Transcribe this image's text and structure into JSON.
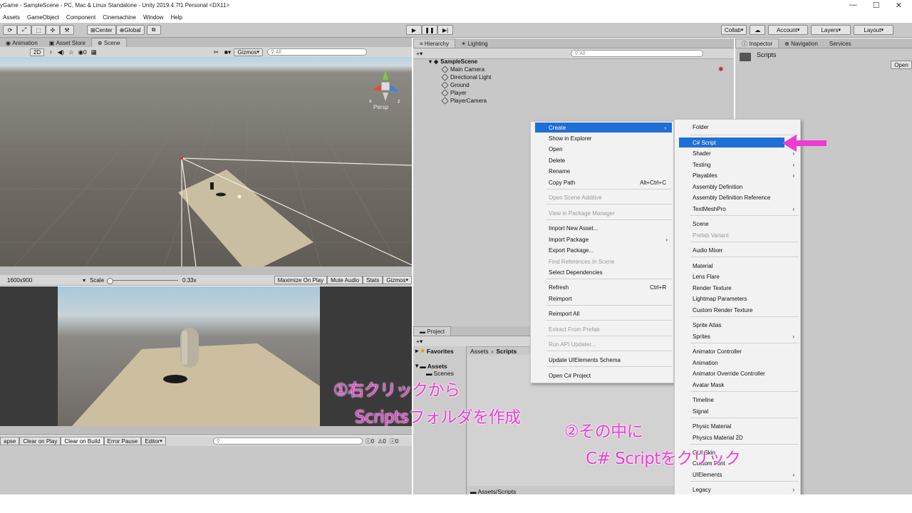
{
  "window": {
    "title": "yGame - SampleScene - PC, Mac & Linux Standalone - Unity 2019.4.7f1 Personal <DX11>",
    "controls": [
      "—",
      "☐",
      "✕"
    ]
  },
  "menubar": [
    "Assets",
    "GameObject",
    "Component",
    "Cinemachine",
    "Window",
    "Help"
  ],
  "toolbar": {
    "center": "Center",
    "global": "Global",
    "collab": "Collab",
    "account": "Account",
    "layers": "Layers",
    "layout": "Layout"
  },
  "scene_tabs": [
    "Animation",
    "Asset Store",
    "Scene"
  ],
  "scene_bar": {
    "mode2d": "2D",
    "count": "0",
    "gizmos": "Gizmos",
    "search": "All",
    "persp": "Persp"
  },
  "game_bar": {
    "resolution": "1600x900",
    "scale_label": "Scale",
    "scale_value": "0.33x",
    "maximize": "Maximize On Play",
    "mute": "Mute Audio",
    "stats": "Stats",
    "gizmos": "Gizmos"
  },
  "console_bar": {
    "collapse": "apse",
    "clear_on_play": "Clear on Play",
    "clear_on_build": "Clear on Build",
    "error_pause": "Error Pause",
    "editor": "Editor",
    "count1": "0",
    "count2": "0",
    "count3": "0"
  },
  "hierarchy": {
    "tabs": [
      "Hierarchy",
      "Lighting"
    ],
    "search": "All",
    "scene": "SampleScene",
    "items": [
      "Main Camera",
      "Directional Light",
      "Ground",
      "Player",
      "PlayerCamera"
    ]
  },
  "inspector": {
    "tabs": [
      "Inspector",
      "Navigation",
      "Services"
    ],
    "object": "Scripts",
    "open_button": "Open"
  },
  "project": {
    "tab": "Project",
    "favorites": "Favorites",
    "assets": "Assets",
    "scenes": "Scenes",
    "breadcrumb_root": "Assets",
    "breadcrumb_sep": "›",
    "breadcrumb_current": "Scripts",
    "footer_path": "Assets/Scripts"
  },
  "context_menu": [
    {
      "label": "Create",
      "highlight": true,
      "submenu": true
    },
    {
      "label": "Show in Explorer"
    },
    {
      "label": "Open"
    },
    {
      "label": "Delete"
    },
    {
      "label": "Rename"
    },
    {
      "label": "Copy Path",
      "shortcut": "Alt+Ctrl+C"
    },
    {
      "label": "Open Scene Additive",
      "disabled": true
    },
    {
      "label": "View in Package Manager",
      "disabled": true
    },
    {
      "label": "Import New Asset..."
    },
    {
      "label": "Import Package",
      "submenu": true
    },
    {
      "label": "Export Package..."
    },
    {
      "label": "Find References In Scene",
      "disabled": true
    },
    {
      "label": "Select Dependencies"
    },
    {
      "label": "Refresh",
      "shortcut": "Ctrl+R"
    },
    {
      "label": "Reimport"
    },
    {
      "label": "Reimport All"
    },
    {
      "label": "Extract From Prefab",
      "disabled": true
    },
    {
      "label": "Run API Updater...",
      "disabled": true
    },
    {
      "label": "Update UIElements Schema"
    },
    {
      "label": "Open C# Project"
    }
  ],
  "create_submenu": [
    {
      "label": "Folder"
    },
    {
      "label": "C# Script",
      "highlight": true
    },
    {
      "label": "Shader",
      "submenu": true
    },
    {
      "label": "Testing",
      "submenu": true
    },
    {
      "label": "Playables",
      "submenu": true
    },
    {
      "label": "Assembly Definition"
    },
    {
      "label": "Assembly Definition Reference"
    },
    {
      "label": "TextMeshPro",
      "submenu": true
    },
    {
      "label": "Scene"
    },
    {
      "label": "Prefab Variant",
      "disabled": true
    },
    {
      "label": "Audio Mixer"
    },
    {
      "label": "Material"
    },
    {
      "label": "Lens Flare"
    },
    {
      "label": "Render Texture"
    },
    {
      "label": "Lightmap Parameters"
    },
    {
      "label": "Custom Render Texture"
    },
    {
      "label": "Sprite Atlas"
    },
    {
      "label": "Sprites",
      "submenu": true
    },
    {
      "label": "Animator Controller"
    },
    {
      "label": "Animation"
    },
    {
      "label": "Animator Override Controller"
    },
    {
      "label": "Avatar Mask"
    },
    {
      "label": "Timeline"
    },
    {
      "label": "Signal"
    },
    {
      "label": "Physic Material"
    },
    {
      "label": "Physics Material 2D"
    },
    {
      "label": "GUI Skin"
    },
    {
      "label": "Custom Font"
    },
    {
      "label": "UIElements",
      "submenu": true
    },
    {
      "label": "Legacy",
      "submenu": true
    }
  ],
  "annotations": {
    "step1_line1": "①右クリックから",
    "step1_line2": "Scriptsフォルダを作成",
    "step2_line1": "②その中に",
    "step2_line2": "C# Scriptをクリック"
  },
  "colors": {
    "highlight": "#1f6fd6",
    "annotation": "#ee3bd4",
    "panel": "#c8c8c8"
  }
}
